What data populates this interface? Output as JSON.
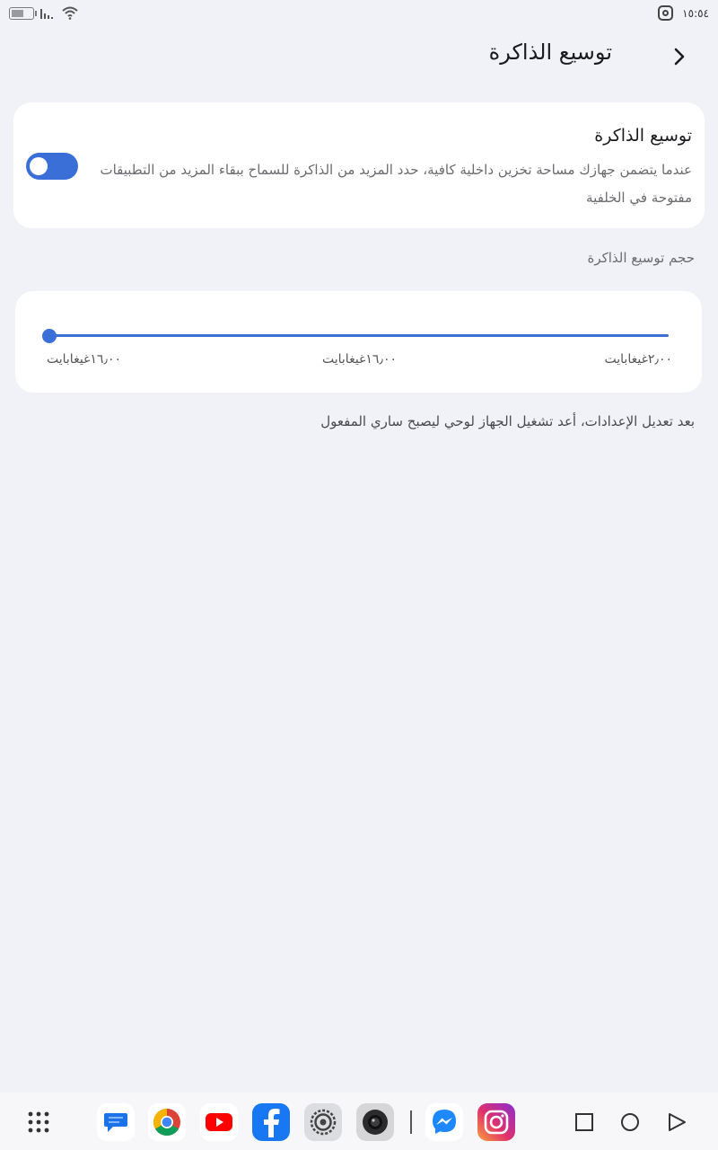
{
  "status_bar": {
    "time": "١٥:٥٤",
    "battery_level": 0.6,
    "icons": [
      "battery-icon",
      "signal-icon",
      "wifi-icon",
      "instagram-notification-icon"
    ]
  },
  "header": {
    "title": "توسيع الذاكرة",
    "back_icon": "chevron-right-icon"
  },
  "memory_extension": {
    "title": "توسيع الذاكرة",
    "description": "عندما يتضمن جهازك مساحة تخزين داخلية كافية، حدد المزيد من الذاكرة للسماح ببقاء المزيد من التطبيقات مفتوحة في الخلفية",
    "enabled": true
  },
  "size_section": {
    "label": "حجم توسيع الذاكرة",
    "slider_value_fraction": 0.0,
    "ticks": {
      "left": "١٦٫٠٠غيغابايت",
      "middle": "١٦٫٠٠غيغابايت",
      "right": "٢٫٠٠غيغابايت"
    }
  },
  "note": "بعد تعديل الإعدادات، أعد تشغيل الجهاز لوحي ليصبح ساري المفعول",
  "dock": {
    "apps": [
      "apps-grid-icon",
      "messages-icon",
      "chrome-icon",
      "youtube-icon",
      "facebook-icon",
      "settings-icon",
      "camera-icon",
      "messenger-icon",
      "instagram-icon"
    ],
    "nav": [
      "recents-icon",
      "home-icon",
      "back-icon"
    ]
  },
  "colors": {
    "accent": "#3a6fd8",
    "background": "#f1f2f7",
    "card": "#ffffff"
  }
}
